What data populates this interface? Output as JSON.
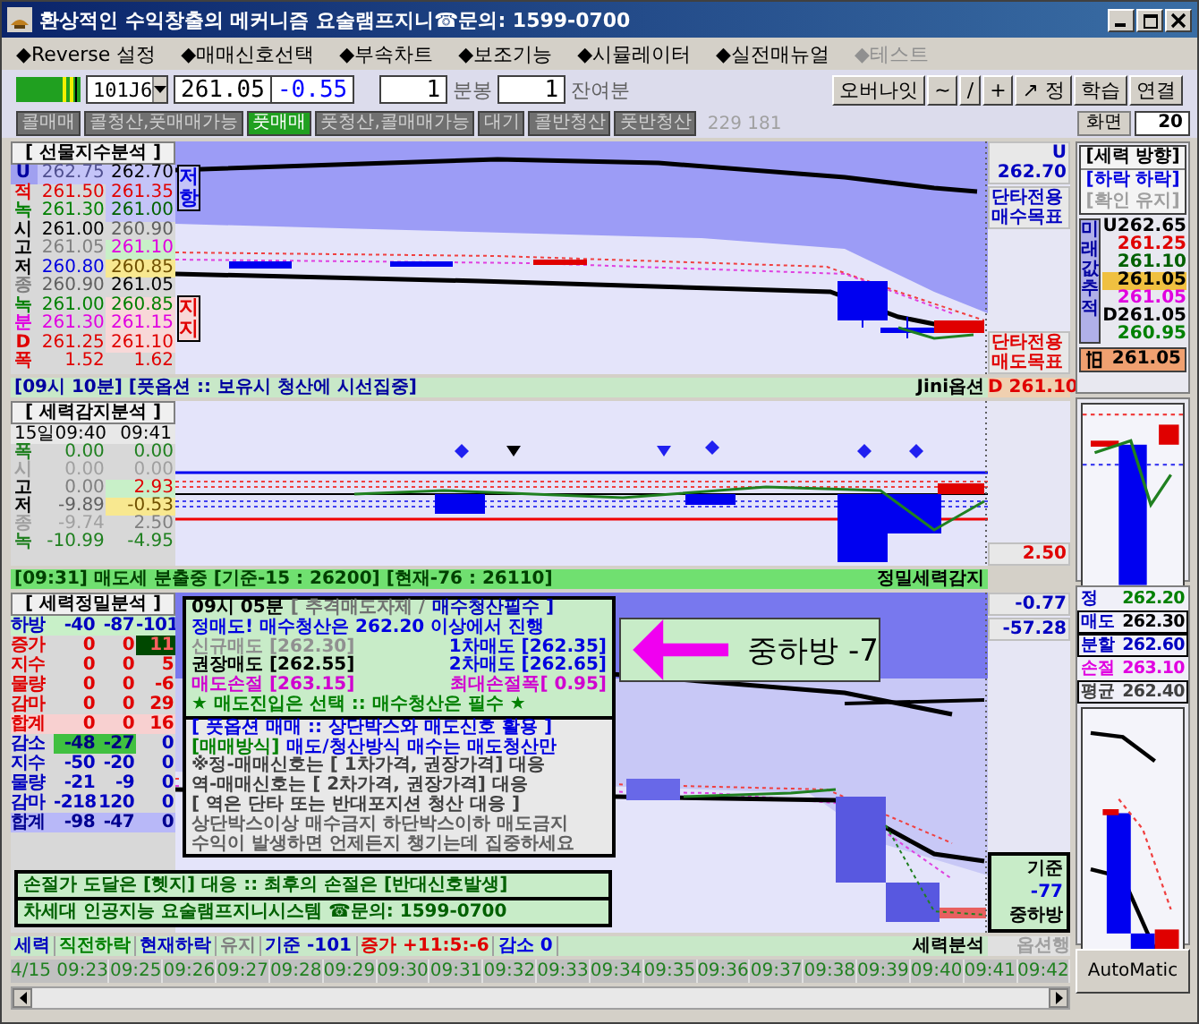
{
  "window": {
    "title": "환상적인 수익창출의 메커니즘 요술램프지니☎문의: 1599-0700"
  },
  "menu": [
    {
      "label": "◆Reverse 설정",
      "disabled": false
    },
    {
      "label": "◆매매신호선택",
      "disabled": false
    },
    {
      "label": "◆부속차트",
      "disabled": false
    },
    {
      "label": "◆보조기능",
      "disabled": false
    },
    {
      "label": "◆시뮬레이터",
      "disabled": false
    },
    {
      "label": "◆실전매뉴얼",
      "disabled": false
    },
    {
      "label": "◆테스트",
      "disabled": true
    }
  ],
  "toolbar": {
    "code": "101J6",
    "price": "261.05",
    "change": "-0.55",
    "period": "1",
    "period_unit": "분봉",
    "remaining": "1",
    "remaining_unit": "잔여분",
    "buttons": [
      "오버나잇",
      "~",
      "/",
      "+",
      "↗ 정",
      "학습",
      "연결"
    ]
  },
  "signals": [
    {
      "label": "콜매매",
      "selected": false
    },
    {
      "label": "콜청산,풋매매가능",
      "selected": false
    },
    {
      "label": "풋매매",
      "selected": true
    },
    {
      "label": "풋청산,콜매매가능",
      "selected": false
    },
    {
      "label": "대기",
      "selected": false
    },
    {
      "label": "콜반청산",
      "selected": false
    },
    {
      "label": "풋반청산",
      "selected": false
    }
  ],
  "signal_count": "229 181",
  "screen": {
    "label": "화면",
    "value": "20"
  },
  "futures_panel": {
    "title": "[ 선물지수분석 ]",
    "rows": [
      {
        "cells": [
          {
            "text": "U",
            "kind": "blue"
          },
          {
            "text": "262.75",
            "color": "#505090",
            "kind": "lavender"
          },
          {
            "text": "262.70",
            "color": "#000000",
            "kind": "lavender"
          }
        ]
      },
      {
        "cells": [
          {
            "text": "적",
            "color": "#e00000",
            "kind": "plain"
          },
          {
            "text": "261.50",
            "color": "#e00000",
            "kind": "plain"
          },
          {
            "text": "261.35",
            "color": "#e00000",
            "kind": "lavender"
          }
        ]
      },
      {
        "cells": [
          {
            "text": "녹",
            "color": "#008000",
            "kind": "plain"
          },
          {
            "text": "261.30",
            "color": "#008000",
            "kind": "plain"
          },
          {
            "text": "261.00",
            "color": "#006000",
            "kind": "lavender"
          }
        ]
      },
      {
        "cells": [
          {
            "text": "시",
            "color": "#000000",
            "kind": "plain"
          },
          {
            "text": "261.00",
            "color": "#000000",
            "kind": "plain"
          },
          {
            "text": "260.90",
            "color": "#606060",
            "kind": "plain"
          }
        ]
      },
      {
        "cells": [
          {
            "text": "고",
            "color": "#000000",
            "kind": "plain"
          },
          {
            "text": "261.05",
            "color": "#808080",
            "kind": "plain"
          },
          {
            "text": "261.10",
            "color": "#e000e0",
            "kind": "mint"
          }
        ]
      },
      {
        "cells": [
          {
            "text": "저",
            "color": "#000000",
            "kind": "plain"
          },
          {
            "text": "260.80",
            "color": "#0000e0",
            "kind": "plain"
          },
          {
            "text": "260.85",
            "kind": "yellow"
          }
        ]
      },
      {
        "cells": [
          {
            "text": "종",
            "color": "#808080",
            "kind": "plain"
          },
          {
            "text": "260.90",
            "color": "#606060",
            "kind": "plain"
          },
          {
            "text": "261.05",
            "color": "#000000",
            "kind": "plain"
          }
        ]
      },
      {
        "cells": [
          {
            "text": "녹",
            "color": "#008000",
            "kind": "plain"
          },
          {
            "text": "261.00",
            "color": "#008000",
            "kind": "plain"
          },
          {
            "text": "260.85",
            "color": "#008000",
            "kind": "pink"
          }
        ]
      },
      {
        "cells": [
          {
            "text": "분",
            "color": "#e000e0",
            "kind": "plain"
          },
          {
            "text": "261.30",
            "color": "#e000e0",
            "kind": "plain"
          },
          {
            "text": "261.15",
            "color": "#e000e0",
            "kind": "pink"
          }
        ]
      },
      {
        "cells": [
          {
            "text": "D",
            "color": "#e00000",
            "kind": "plain"
          },
          {
            "text": "261.25",
            "color": "#e00000",
            "kind": "plain"
          },
          {
            "text": "261.10",
            "color": "#e00000",
            "kind": "pink"
          }
        ]
      },
      {
        "cells": [
          {
            "text": "폭",
            "color": "#e00000",
            "kind": "plain"
          },
          {
            "text": "1.52",
            "color": "#e00000",
            "kind": "plain"
          },
          {
            "text": "1.62",
            "color": "#e00000",
            "kind": "plain"
          }
        ]
      }
    ],
    "resistance": "저항",
    "support": "지지",
    "upper": "U 262.70",
    "buy_target": "단타전용 매수목표",
    "sell_target": "단타전용 매도목표",
    "status": "[09시 10분] [풋옵션 :: 보유시 청산에 시선집중]",
    "status_tag": "Jini옵션",
    "status_value": "D 261.10"
  },
  "force_panel": {
    "title": "[ 세력감지분석 ]",
    "times": [
      "15일09:40",
      "09:41"
    ],
    "rows": [
      {
        "cells": [
          {
            "text": "폭",
            "color": "#208020",
            "kind": "plain"
          },
          {
            "text": "0.00",
            "color": "#208020",
            "kind": "plain"
          },
          {
            "text": "0.00",
            "color": "#208020",
            "kind": "plain"
          }
        ]
      },
      {
        "cells": [
          {
            "text": "시",
            "color": "#a0a0a0",
            "kind": "plain"
          },
          {
            "text": "0.00",
            "color": "#a0a0a0",
            "kind": "plain"
          },
          {
            "text": "0.00",
            "color": "#a0a0a0",
            "kind": "plain"
          }
        ]
      },
      {
        "cells": [
          {
            "text": "고",
            "color": "#000000",
            "kind": "plain"
          },
          {
            "text": "0.00",
            "color": "#808080",
            "kind": "plain"
          },
          {
            "text": "2.93",
            "color": "#e00000",
            "kind": "mint"
          }
        ]
      },
      {
        "cells": [
          {
            "text": "저",
            "color": "#000000",
            "kind": "plain"
          },
          {
            "text": "-9.89",
            "color": "#606060",
            "kind": "plain"
          },
          {
            "text": "-0.53",
            "kind": "yellow"
          }
        ]
      },
      {
        "cells": [
          {
            "text": "종",
            "color": "#a0a0a0",
            "kind": "plain"
          },
          {
            "text": "-9.74",
            "color": "#a0a0a0",
            "kind": "plain"
          },
          {
            "text": "2.50",
            "color": "#808080",
            "kind": "plain"
          }
        ]
      },
      {
        "cells": [
          {
            "text": "녹",
            "color": "#208020",
            "kind": "plain"
          },
          {
            "text": "-10.99",
            "color": "#208020",
            "kind": "plain"
          },
          {
            "text": "-4.95",
            "color": "#208020",
            "kind": "plain"
          }
        ]
      }
    ],
    "value": "2.50",
    "status": "[09:31] 매도세 분출중 [기준-15 : 26200] [현재-76 : 26110]",
    "status_tag": "정밀세력감지"
  },
  "precision_panel": {
    "title": "[ 세력정밀분석 ]",
    "rows": [
      {
        "cells": [
          {
            "text": "하방",
            "color": "#0000c0",
            "kind": "mint"
          },
          {
            "text": "-40",
            "color": "#0000c0",
            "kind": "mint"
          },
          {
            "text": "-87",
            "color": "#0000c0",
            "kind": "mint"
          },
          {
            "text": "-101",
            "color": "#0000c0",
            "kind": "mint"
          }
        ]
      },
      {
        "cells": [
          {
            "text": "증가",
            "color": "#e00000",
            "kind": "plain"
          },
          {
            "text": "0",
            "color": "#e00000",
            "kind": "plain"
          },
          {
            "text": "0",
            "color": "#e00000",
            "kind": "plain"
          },
          {
            "text": "11",
            "kind": "green"
          }
        ]
      },
      {
        "cells": [
          {
            "text": "지수",
            "color": "#e00000",
            "kind": "plain"
          },
          {
            "text": "0",
            "color": "#e00000",
            "kind": "plain"
          },
          {
            "text": "0",
            "color": "#e00000",
            "kind": "plain"
          },
          {
            "text": "5",
            "color": "#e00000",
            "kind": "plain"
          }
        ]
      },
      {
        "cells": [
          {
            "text": "물량",
            "color": "#e00000",
            "kind": "plain"
          },
          {
            "text": "0",
            "color": "#e00000",
            "kind": "plain"
          },
          {
            "text": "0",
            "color": "#e00000",
            "kind": "plain"
          },
          {
            "text": "-6",
            "color": "#e00000",
            "kind": "plain"
          }
        ]
      },
      {
        "cells": [
          {
            "text": "감마",
            "color": "#e00000",
            "kind": "plain"
          },
          {
            "text": "0",
            "color": "#e00000",
            "kind": "plain"
          },
          {
            "text": "0",
            "color": "#e00000",
            "kind": "plain"
          },
          {
            "text": "29",
            "color": "#e00000",
            "kind": "plain"
          }
        ]
      },
      {
        "cells": [
          {
            "text": "합계",
            "color": "#e00000",
            "kind": "rose"
          },
          {
            "text": "0",
            "color": "#e00000",
            "kind": "rose"
          },
          {
            "text": "0",
            "color": "#e00000",
            "kind": "rose"
          },
          {
            "text": "16",
            "color": "#e00000",
            "kind": "rose"
          }
        ]
      },
      {
        "cells": [
          {
            "text": "감소",
            "color": "#0000c0",
            "kind": "plain"
          },
          {
            "text": "-48",
            "kind": "lime"
          },
          {
            "text": "-27",
            "kind": "lime"
          },
          {
            "text": "0",
            "color": "#0000c0",
            "kind": "plain"
          }
        ]
      },
      {
        "cells": [
          {
            "text": "지수",
            "color": "#0000c0",
            "kind": "plain"
          },
          {
            "text": "-50",
            "color": "#0000c0",
            "kind": "plain"
          },
          {
            "text": "-20",
            "color": "#0000c0",
            "kind": "plain"
          },
          {
            "text": "0",
            "color": "#0000c0",
            "kind": "plain"
          }
        ]
      },
      {
        "cells": [
          {
            "text": "물량",
            "color": "#0000c0",
            "kind": "plain"
          },
          {
            "text": "-21",
            "color": "#0000c0",
            "kind": "plain"
          },
          {
            "text": "-9",
            "color": "#0000c0",
            "kind": "plain"
          },
          {
            "text": "0",
            "color": "#0000c0",
            "kind": "plain"
          }
        ]
      },
      {
        "cells": [
          {
            "text": "감마",
            "color": "#0000c0",
            "kind": "plain"
          },
          {
            "text": "-218",
            "color": "#0000c0",
            "kind": "plain"
          },
          {
            "text": "120",
            "color": "#0000c0",
            "kind": "plain"
          },
          {
            "text": "0",
            "color": "#0000c0",
            "kind": "plain"
          }
        ]
      },
      {
        "cells": [
          {
            "text": "합계",
            "color": "#000090",
            "kind": "violet"
          },
          {
            "text": "-98",
            "color": "#000090",
            "kind": "violet"
          },
          {
            "text": "-47",
            "color": "#000090",
            "kind": "violet"
          },
          {
            "text": "0",
            "color": "#000090",
            "kind": "violet"
          }
        ]
      }
    ],
    "advice": [
      {
        "kind": "flow",
        "segments": [
          {
            "text": "09시 05분",
            "color": "#000000"
          },
          {
            "text": "[ 추격매도자제 /",
            "color": "#707070"
          },
          {
            "text": "매수청산필수 ]",
            "color": "#0000c0"
          }
        ]
      },
      {
        "kind": "flow",
        "segments": [
          {
            "text": "정매도! 매수청산은 262.20 이상에서 진행",
            "color": "#0000e0"
          }
        ]
      },
      {
        "kind": "split",
        "segments": [
          {
            "text": "신규매도 [262.30]",
            "color": "#909090"
          },
          {
            "text": "1차매도 [262.35]",
            "color": "#0000e0"
          }
        ]
      },
      {
        "kind": "split",
        "segments": [
          {
            "text": "권장매도 [262.55]",
            "color": "#000000"
          },
          {
            "text": "2차매도 [262.65]",
            "color": "#0000e0"
          }
        ]
      },
      {
        "kind": "split",
        "segments": [
          {
            "text": "매도손절 [263.15]",
            "color": "#d000d0"
          },
          {
            "text": "최대손절폭[ 0.95]",
            "color": "#d000d0"
          }
        ]
      },
      {
        "kind": "flow",
        "segments": [
          {
            "text": "★ 매도진입은 선택  ::  매수청산은 필수 ★",
            "color": "#008000"
          }
        ]
      }
    ],
    "guide": [
      {
        "segments": [
          {
            "text": "[ 풋옵션 매매 :: 상단박스와 매도신호 활용 ]",
            "color": "#0000e0"
          }
        ]
      },
      {
        "segments": [
          {
            "text": "[매매방식]",
            "color": "#008000"
          },
          {
            "text": "매도/청산방식 매수는 매도청산만",
            "color": "#0000e0"
          }
        ]
      },
      {
        "segments": [
          {
            "text": "※정-매매신호는 [ 1차가격, 권장가격] 대응",
            "color": "#404040"
          }
        ]
      },
      {
        "segments": [
          {
            "text": "역-매매신호는 [ 2차가격, 권장가격] 대응",
            "color": "#404040"
          }
        ]
      },
      {
        "segments": [
          {
            "text": "[ 역은 단타 또는  반대포지션 청산 대응 ]",
            "color": "#404040"
          }
        ]
      },
      {
        "segments": [
          {
            "text": "상단박스이상 매수금지  하단박스이하 매도금지",
            "color": "#606060"
          }
        ]
      },
      {
        "segments": [
          {
            "text": "수익이 발생하면 언제든지 챙기는데 집중하세요",
            "color": "#606060"
          }
        ]
      }
    ],
    "notes": [
      "손절가 도달은 [헷지] 대응 :: 최후의 손절은 [반대신호발생]",
      "차세대 인공지능 요술램프지니시스템 ☎문의: 1599-0700"
    ],
    "callout": "중하방 -7",
    "readings": [
      "-0.77",
      "-57.28"
    ],
    "signal": [
      "기준",
      "-77",
      "중하방"
    ],
    "status": [
      {
        "text": "세력",
        "color": "#0000c0"
      },
      {
        "text": "직전하락",
        "color": "#008000"
      },
      {
        "text": "현재하락",
        "color": "#0000c0"
      },
      {
        "text": "유지",
        "color": "#808080"
      },
      {
        "text": "기준 -101",
        "color": "#0000c0"
      },
      {
        "text": "증가 +11:5:-6",
        "color": "#e00000"
      },
      {
        "text": "감소 0",
        "color": "#0000e0"
      }
    ],
    "status_tag": "세력분석",
    "status_value": "옵션행"
  },
  "times": [
    "4/15 09:23",
    "09:25",
    "09:26",
    "09:27",
    "09:28",
    "09:29",
    "09:30",
    "09:31",
    "09:32",
    "09:33",
    "09:34",
    "09:35",
    "09:36",
    "09:37",
    "09:38",
    "09:39",
    "09:40",
    "09:41",
    "09:42"
  ],
  "direction": {
    "title": "[세력 방향]",
    "state": "[하락 하락]",
    "confirm": "[확인 유지]"
  },
  "future": {
    "label": "미래값추적",
    "values": [
      {
        "text": "U262.65",
        "color": "#000000",
        "kind": "plain"
      },
      {
        "text": "261.25",
        "color": "#e00000",
        "kind": "plain"
      },
      {
        "text": "261.10",
        "color": "#006000",
        "kind": "plain"
      },
      {
        "text": "261.05",
        "kind": "gold"
      },
      {
        "text": "261.05",
        "color": "#e000e0",
        "kind": "plain"
      },
      {
        "text": "D261.05",
        "color": "#000000",
        "kind": "plain"
      },
      {
        "text": "260.95",
        "color": "#008000",
        "kind": "plain"
      }
    ]
  },
  "current": "261.05",
  "orders": [
    {
      "label": {
        "text": "정",
        "color": "#0000c0"
      },
      "value": {
        "text": "262.20",
        "color": "#008000"
      },
      "boxed": false
    },
    {
      "label": {
        "text": "매도",
        "color": "#0000c0"
      },
      "value": {
        "text": "262.30",
        "color": "#000000"
      },
      "boxed": true
    },
    {
      "label": {
        "text": "분할",
        "color": "#0000c0"
      },
      "value": {
        "text": "262.60",
        "color": "#0000c0"
      },
      "boxed": true
    },
    {
      "label": {
        "text": "손절",
        "color": "#e000e0"
      },
      "value": {
        "text": "263.10",
        "color": "#e000e0"
      },
      "boxed": false
    },
    {
      "label": {
        "text": "평균",
        "color": "#404040"
      },
      "value": {
        "text": "262.40",
        "color": "#404040"
      },
      "boxed": true
    }
  ],
  "automatic": "AutoMatic"
}
